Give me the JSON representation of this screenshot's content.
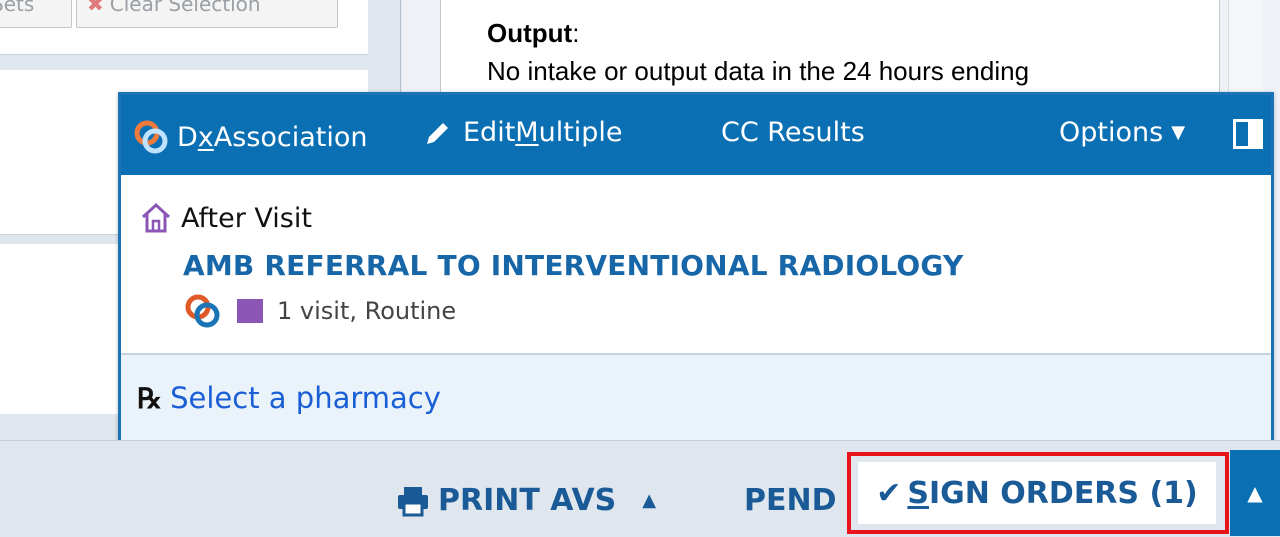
{
  "background": {
    "toolbar_button_1": "Sets",
    "toolbar_button_2": "Clear Selection",
    "note_title": "Output",
    "note_colon": ":",
    "note_text": "No intake or output data in the 24 hours ending"
  },
  "popup": {
    "toolbar": {
      "dx_association_prefix": "D",
      "dx_association_underline": "x",
      "dx_association_suffix": " Association",
      "edit_multiple_prefix": "Edit ",
      "edit_multiple_underline": "M",
      "edit_multiple_suffix": "ultiple",
      "cc_results": "CC Results",
      "options": "Options"
    },
    "order": {
      "section_label": "After Visit",
      "name": "AMB REFERRAL TO INTERVENTIONAL RADIOLOGY",
      "details": "1 visit, Routine",
      "square_color": "#8b56b6"
    },
    "pharmacy": {
      "rx_symbol": "℞",
      "link": "Select a pharmacy"
    }
  },
  "footer": {
    "print_avs": "PRINT AVS",
    "pend": "PEND",
    "sign_orders_underline": "S",
    "sign_orders_rest": "IGN ORDERS (1)",
    "highlight_color": "#e8141a",
    "accent_color": "#0a6fb3"
  }
}
